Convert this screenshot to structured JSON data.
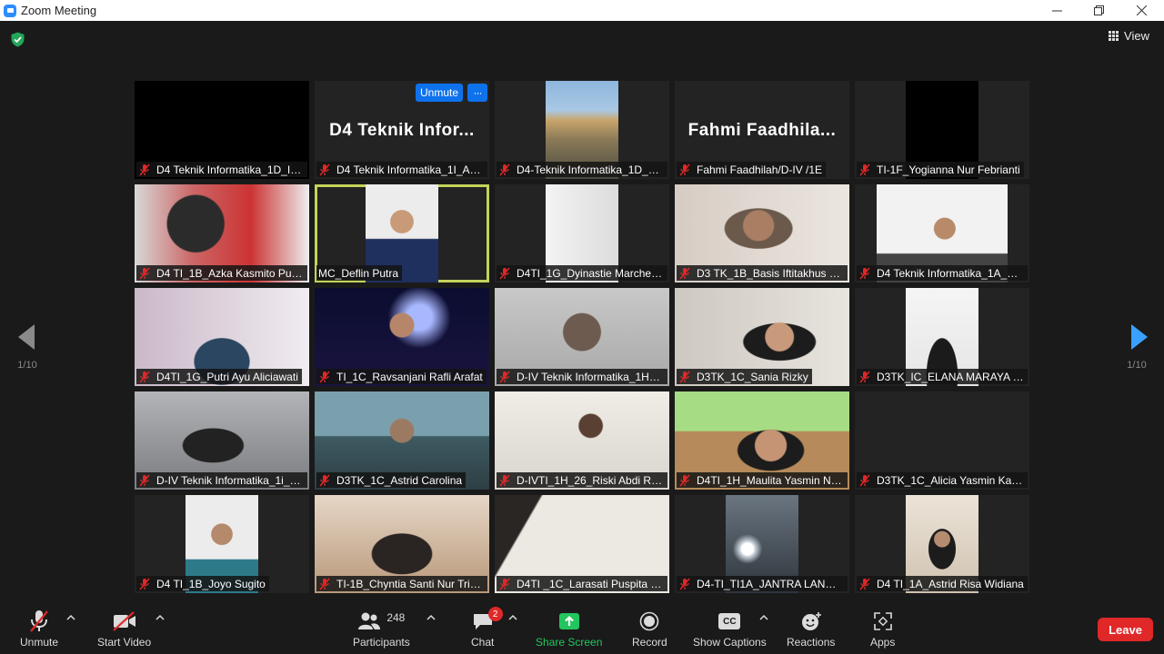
{
  "window": {
    "title": "Zoom Meeting",
    "controls": [
      "minimize-icon",
      "restore-icon",
      "close-icon"
    ]
  },
  "header": {
    "security_icon": "shield-check-icon",
    "view_label": "View"
  },
  "pagination": {
    "left_label": "1/10",
    "right_label": "1/10"
  },
  "participants": [
    {
      "name": "D4 Teknik Informatika_1D_Ih...",
      "muted": true
    },
    {
      "name": "D4 Teknik Informatika_1I_AL ...",
      "muted": true,
      "display_name": "D4 Teknik Infor...",
      "hover_unmute": "Unmute",
      "hover_more": "···"
    },
    {
      "name": "D4-Teknik Informatika_1D_R...",
      "muted": true
    },
    {
      "name": "Fahmi Faadhilah/D-IV /1E",
      "muted": true,
      "display_name": "Fahmi Faadhila..."
    },
    {
      "name": "TI-1F_Yogianna Nur Febrianti",
      "muted": true
    },
    {
      "name": "D4 TI_1B_Azka Kasmito Putra",
      "muted": true
    },
    {
      "name": "MC_Deflin Putra",
      "muted": false,
      "active_speaker": true
    },
    {
      "name": "D4TI_1G_Dyinastie Marcheli...",
      "muted": true
    },
    {
      "name": "D3 TK_1B_Basis Iftitakhus Sa...",
      "muted": true
    },
    {
      "name": "D4 Teknik Informatika_1A_By...",
      "muted": true
    },
    {
      "name": "D4TI_1G_Putri Ayu Aliciawati",
      "muted": true
    },
    {
      "name": "TI_1C_Ravsanjani Rafli Arafat",
      "muted": true
    },
    {
      "name": "D-IV Teknik Informatika_1H_...",
      "muted": true
    },
    {
      "name": "D3TK_1C_Sania Rizky",
      "muted": true
    },
    {
      "name": "D3TK_IC_ELANA MARAYA P...",
      "muted": true
    },
    {
      "name": "D-IV Teknik Informatika_1i_Y...",
      "muted": true
    },
    {
      "name": "D3TK_1C_Astrid Carolina",
      "muted": true
    },
    {
      "name": "D-IVTI_1H_26_Riski Abdi Rah...",
      "muted": true
    },
    {
      "name": "D4TI_1H_Maulita Yasmin Na...",
      "muted": true
    },
    {
      "name": "D3TK_1C_Alicia Yasmin Kais...",
      "muted": true
    },
    {
      "name": "D4 TI_1B_Joyo Sugito",
      "muted": true
    },
    {
      "name": "TI-1B_Chyntia Santi Nur Tris...",
      "muted": true
    },
    {
      "name": "D4TI _1C_Larasati Puspita C...",
      "muted": true
    },
    {
      "name": "D4-TI_TI1A_JANTRA LANG L...",
      "muted": true
    },
    {
      "name": "D4 TI_1A_Astrid Risa Widiana",
      "muted": true
    }
  ],
  "toolbar": {
    "unmute": "Unmute",
    "start_video": "Start Video",
    "participants": "Participants",
    "participants_count": "248",
    "chat": "Chat",
    "chat_badge": "2",
    "share_screen": "Share Screen",
    "record": "Record",
    "show_captions": "Show Captions",
    "captions_icon_text": "CC",
    "reactions": "Reactions",
    "apps": "Apps",
    "leave": "Leave"
  },
  "colors": {
    "background": "#1a1a1a",
    "tile": "#232323",
    "active_speaker_border": "#c4d35a",
    "accent_blue": "#0e72ed",
    "share_green": "#22c55e",
    "leave_red": "#e02828",
    "muted_red": "#e02828"
  }
}
